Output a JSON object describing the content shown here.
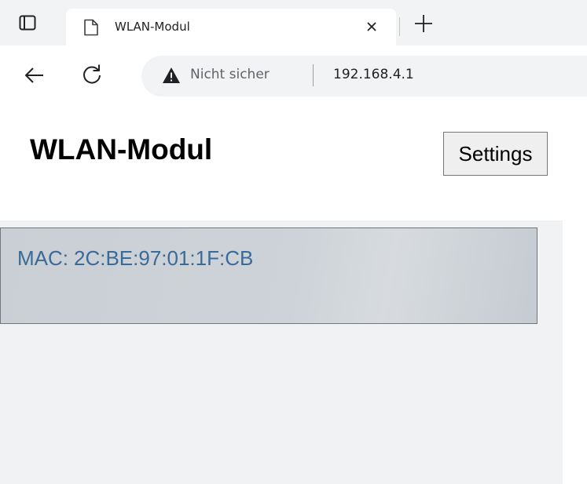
{
  "browser": {
    "tab": {
      "title": "WLAN-Modul",
      "icon": "page-icon"
    },
    "security_label": "Nicht sicher",
    "url": "192.168.4.1",
    "icons": {
      "window": "window-icon",
      "close": "close-icon",
      "new_tab": "plus-icon",
      "back": "arrow-left-icon",
      "reload": "reload-icon",
      "warning": "warning-icon"
    }
  },
  "page": {
    "title": "WLAN-Modul",
    "settings_label": "Settings",
    "mac": {
      "label": "MAC:",
      "value": "2C:BE:97:01:1F:CB"
    }
  },
  "colors": {
    "chrome_bg": "#f1f3f4",
    "panel_bg": "#f1f2f4",
    "mac_text": "#3a6a98",
    "mac_box_border": "#6f767c"
  }
}
